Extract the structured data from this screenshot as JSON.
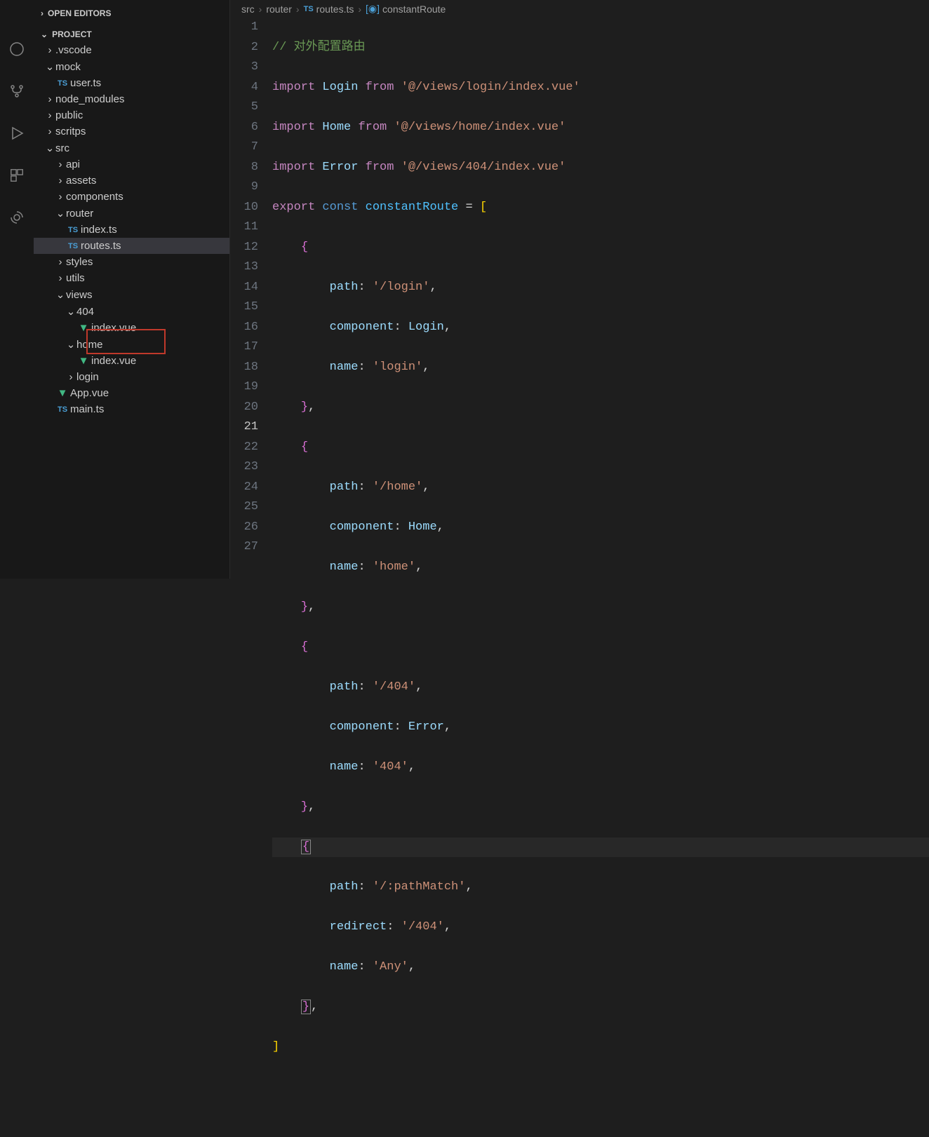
{
  "sections": {
    "openEditors": "OPEN EDITORS",
    "project": "PROJECT"
  },
  "tree": {
    "vscode": ".vscode",
    "mock": "mock",
    "user_ts": "user.ts",
    "node_modules": "node_modules",
    "public": "public",
    "scritps": "scritps",
    "src": "src",
    "api": "api",
    "assets": "assets",
    "components": "components",
    "router": "router",
    "index_ts": "index.ts",
    "routes_ts": "routes.ts",
    "styles": "styles",
    "utils": "utils",
    "views": "views",
    "404": "404",
    "index_vue": "index.vue",
    "home": "home",
    "index_vue2": "index.vue",
    "login": "login",
    "app_vue": "App.vue",
    "main_ts": "main.ts"
  },
  "breadcrumb": {
    "seg1": "src",
    "seg2": "router",
    "ts": "TS",
    "file": "routes.ts",
    "symbol": "constantRoute"
  },
  "lines": [
    "1",
    "2",
    "3",
    "4",
    "5",
    "6",
    "7",
    "8",
    "9",
    "10",
    "11",
    "12",
    "13",
    "14",
    "15",
    "16",
    "17",
    "18",
    "19",
    "20",
    "21",
    "22",
    "23",
    "24",
    "25",
    "26",
    "27"
  ],
  "code": {
    "l1_comment": "// 对外配置路由",
    "import": "import",
    "from": "from",
    "export": "export",
    "const": "const",
    "Login": "Login",
    "Home": "Home",
    "Error": "Error",
    "constantRoute": "constantRoute",
    "s_login_path": "'@/views/login/index.vue'",
    "s_home_path": "'@/views/home/index.vue'",
    "s_404_path": "'@/views/404/index.vue'",
    "path": "path",
    "component": "component",
    "name": "name",
    "redirect": "redirect",
    "v_login": "'/login'",
    "v_home": "'/home'",
    "v_404": "'/404'",
    "v_pathMatch": "'/:pathMatch'",
    "v_Any": "'Any'",
    "n_login": "'login'",
    "n_home": "'home'",
    "n_404": "'404'",
    "eq": "=",
    "comma": ",",
    "colon": ":",
    "lbrack": "[",
    "rbrack": "]",
    "lbrace": "{",
    "rbrace": "}"
  }
}
